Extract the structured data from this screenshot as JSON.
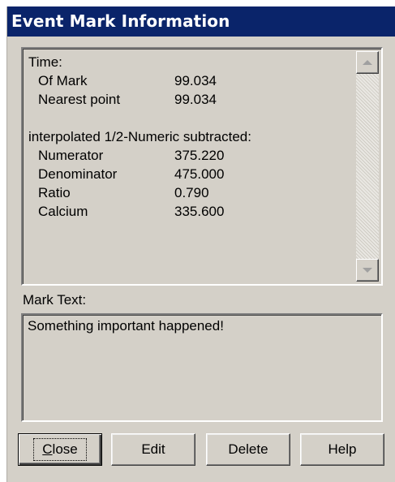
{
  "window": {
    "title": "Event Mark Information"
  },
  "info": {
    "time_heading": "Time:",
    "time_rows": [
      {
        "label": "Of Mark",
        "value": "99.034"
      },
      {
        "label": "Nearest point",
        "value": "99.034"
      }
    ],
    "section_heading": "interpolated 1/2-Numeric subtracted:",
    "section_rows": [
      {
        "label": "Numerator",
        "value": "375.220"
      },
      {
        "label": "Denominator",
        "value": "475.000"
      },
      {
        "label": "Ratio",
        "value": "0.790"
      },
      {
        "label": "Calcium",
        "value": "335.600"
      }
    ]
  },
  "mark": {
    "label": "Mark Text:",
    "text": "Something important happened!"
  },
  "buttons": {
    "close": "Close",
    "edit": "Edit",
    "delete": "Delete",
    "help": "Help"
  },
  "colors": {
    "titlebar": "#0a246a",
    "face": "#d4d0c8"
  }
}
